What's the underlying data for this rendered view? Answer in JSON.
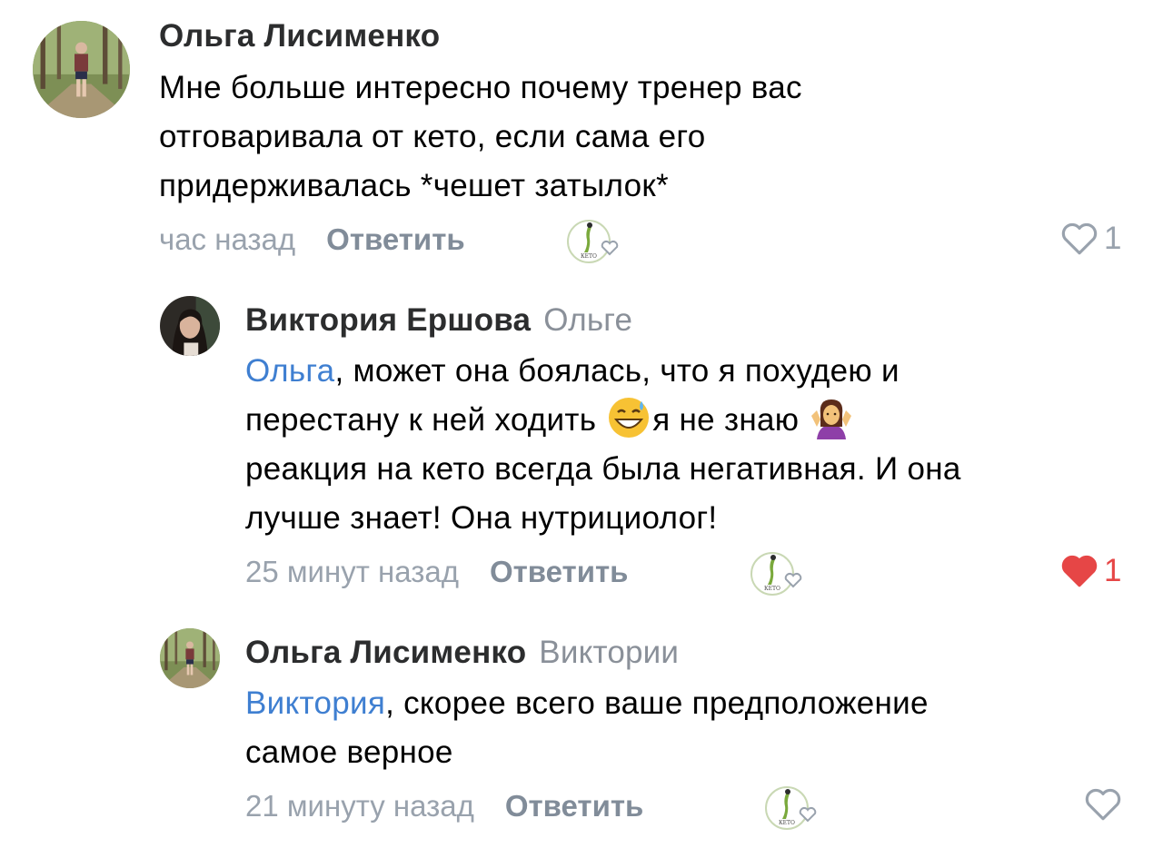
{
  "comments": [
    {
      "author": "Ольга Лисименко",
      "reply_to": "",
      "text_lines": [
        "Мне больше интересно почему тренер вас",
        "отговаривала от кето, если сама его",
        "придерживалась *чешет затылок*"
      ],
      "time": "час назад",
      "reply_label": "Ответить",
      "likes": "1",
      "liked": false,
      "avatar": "avatar-forest-photo"
    },
    {
      "author": "Виктория Ершова",
      "reply_to": "Ольге",
      "mention": "Ольга",
      "text_line1_rest": ", может она боялась, что я похудею и",
      "text_line2_a": "перестану к ней ходить ",
      "text_line2_b": "я не знаю ",
      "text_line3": "реакция на кето всегда была негативная. И она",
      "text_line4": "лучше знает! Она нутрициолог!",
      "emoji1": "grinning-sweat-emoji",
      "emoji2": "shrug-emoji",
      "time": "25 минут назад",
      "reply_label": "Ответить",
      "likes": "1",
      "liked": true,
      "avatar": "avatar-woman-photo"
    },
    {
      "author": "Ольга Лисименко",
      "reply_to": "Виктории",
      "mention": "Виктория",
      "text_line1_rest": ", скорее всего ваше предположение",
      "text_line2": "самое верное",
      "time": "21 минуту назад",
      "reply_label": "Ответить",
      "likes": "",
      "liked": false,
      "avatar": "avatar-forest-photo"
    }
  ],
  "reaction_logo_text": "КЕТО",
  "colors": {
    "mention": "#3f7fd1",
    "liked": "#e64646",
    "muted": "#99a2ad",
    "logo_green": "#7aa93c"
  }
}
